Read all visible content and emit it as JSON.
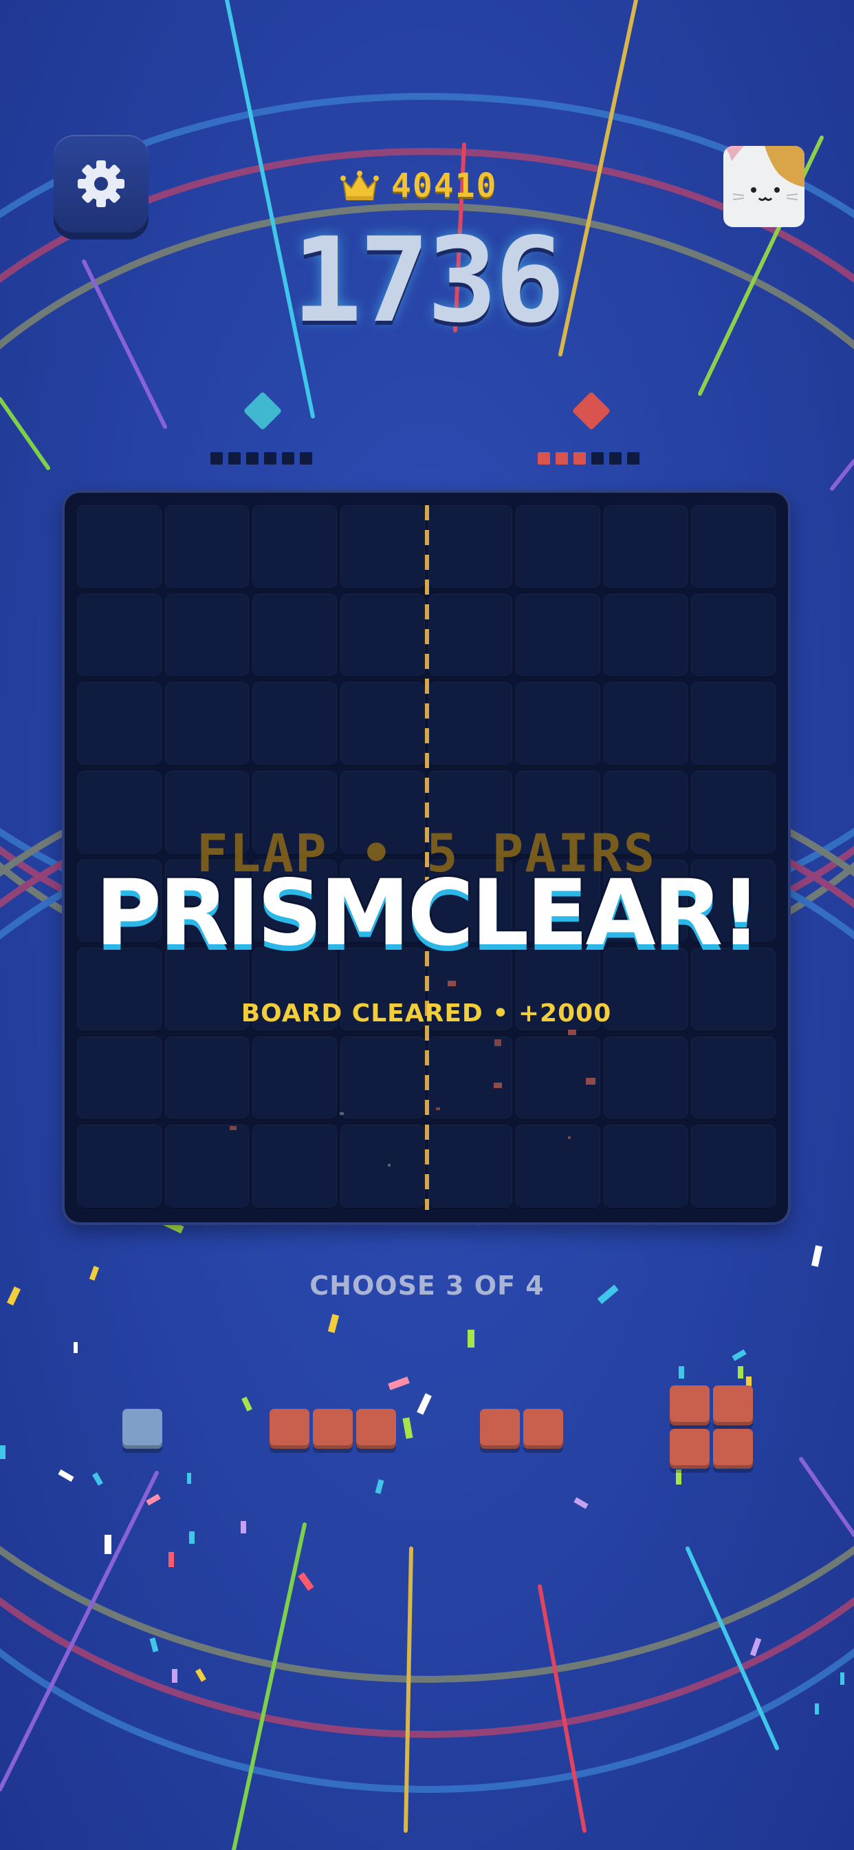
{
  "header": {
    "best_score": "40410",
    "score": "1736",
    "icons": {
      "settings": "gear-icon",
      "best": "crown-icon",
      "avatar": "cat-avatar"
    }
  },
  "players": {
    "left": {
      "gem_color": "#40b8d0",
      "progress": 0,
      "total": 6
    },
    "right": {
      "gem_color": "#d9534f",
      "progress": 3,
      "total": 6
    }
  },
  "board": {
    "rows": 8,
    "cols": 8,
    "flap_text": "FLAP • 5 PAIRS",
    "clear_text": "PRISMCLEAR!",
    "bonus_text": "BOARD CLEARED • +2000"
  },
  "tray": {
    "instruction": "CHOOSE 3 OF 4",
    "pieces": [
      {
        "name": "single-blue",
        "color": "#7f9fc9",
        "cells": 1
      },
      {
        "name": "line-3-red",
        "color": "#c8604d",
        "cells": 3
      },
      {
        "name": "line-2-red",
        "color": "#c8604d",
        "cells": 2
      },
      {
        "name": "square-2x2-red",
        "color": "#c8604d",
        "cells": 4
      }
    ]
  },
  "colors": {
    "background": "#2744a6",
    "accent_cyan": "#2bb7e8",
    "accent_gold": "#f2cf3a",
    "board": "#0b1533"
  }
}
